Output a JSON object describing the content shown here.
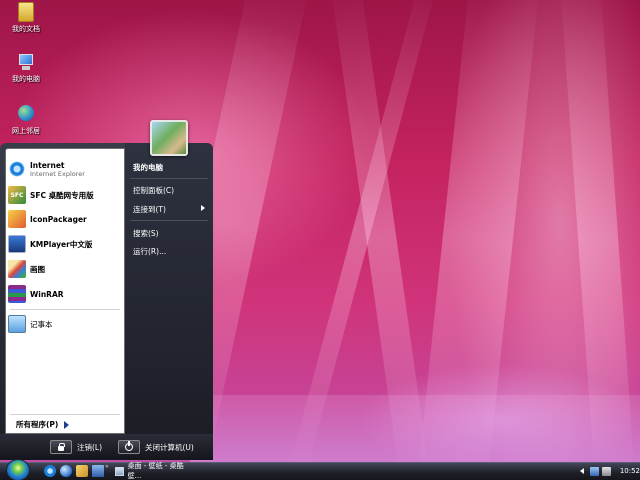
{
  "desktop": {
    "icons": [
      {
        "label": "我的文档",
        "icon": "my-documents-icon"
      },
      {
        "label": "我的电脑",
        "icon": "my-computer-icon"
      },
      {
        "label": "网上邻居",
        "icon": "network-places-icon"
      }
    ]
  },
  "start_menu": {
    "programs": [
      {
        "title": "Internet",
        "subtitle": "Internet Explorer",
        "icon": "internet-explorer-icon"
      },
      {
        "title": "SFC 桌酷网专用版",
        "icon": "sfc-icon",
        "icon_text": "SFC"
      },
      {
        "title": "IconPackager",
        "icon": "iconpackager-icon"
      },
      {
        "title": "KMPlayer中文版",
        "icon": "kmplayer-icon"
      },
      {
        "title": "画图",
        "icon": "paint-icon"
      },
      {
        "title": "WinRAR",
        "icon": "winrar-icon"
      },
      {
        "title": "记事本",
        "icon": "notepad-icon"
      }
    ],
    "all_programs": "所有程序(P)",
    "right_items": [
      {
        "label": "我的电脑",
        "bold": true
      },
      {
        "label": "控制面板(C)"
      },
      {
        "label": "连接到(T)",
        "has_submenu": true
      },
      {
        "label": "搜索(S)"
      },
      {
        "label": "运行(R)..."
      }
    ],
    "logoff": "注销(L)",
    "shutdown": "关闭计算机(U)"
  },
  "taskbar": {
    "active_window": "桌面 - 壁纸 - 桌酷壁...",
    "quick_launch": [
      "internet-explorer-icon",
      "globe-icon",
      "explorer-icon",
      "show-desktop-icon"
    ],
    "more": "»",
    "clock": "10:52"
  },
  "colors": {
    "wallpaper": "#c4235f",
    "menu_dark": "#1d1f27",
    "taskbar": "#1d1f27"
  }
}
